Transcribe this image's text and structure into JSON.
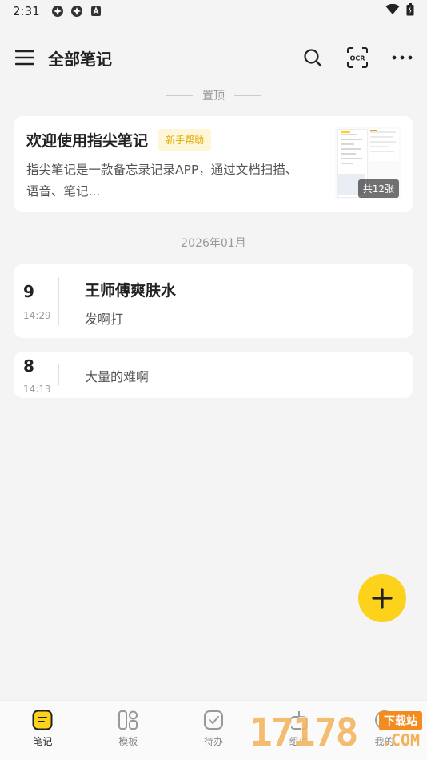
{
  "status_bar": {
    "time": "2:31"
  },
  "app_bar": {
    "title": "全部笔记"
  },
  "pinned_section": {
    "label": "置顶",
    "note": {
      "title": "欢迎使用指尖笔记",
      "badge": "新手帮助",
      "preview": "指尖笔记是一款备忘录记录APP，通过文档扫描、语音、笔记...",
      "image_count": "共12张"
    }
  },
  "month_section": {
    "label": "2026年01月"
  },
  "notes": [
    {
      "day": "9",
      "time": "14:29",
      "title": "王师傅爽肤水",
      "text": "发啊打"
    },
    {
      "day": "8",
      "time": "14:13",
      "title": "",
      "text": "大量的难啊"
    }
  ],
  "bottom_nav": {
    "items": [
      {
        "label": "笔记",
        "icon": "note-icon"
      },
      {
        "label": "模板",
        "icon": "template-icon"
      },
      {
        "label": "待办",
        "icon": "todo-icon"
      },
      {
        "label": "组件",
        "icon": "widget-icon"
      },
      {
        "label": "我的",
        "icon": "profile-icon"
      }
    ]
  },
  "watermark": {
    "digits": "17178",
    "brand": "下载站",
    "domain": ".COM"
  },
  "colors": {
    "accent": "#fdd21a",
    "background": "#f4f4f4",
    "badge_text": "#e0a800"
  }
}
